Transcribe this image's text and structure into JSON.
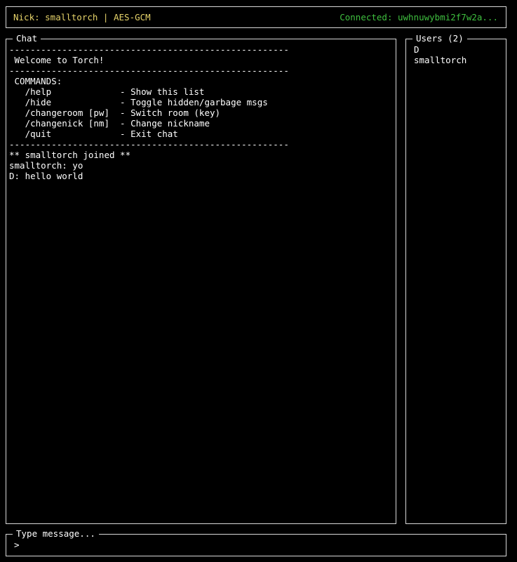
{
  "colors": {
    "nick": "#e6d36a",
    "connected": "#3fbf3f",
    "text": "#ffffff",
    "border": "#d8d8d8",
    "background": "#000000"
  },
  "status": {
    "left": "Nick: smalltorch | AES-GCM",
    "right": "Connected: uwhnuwybmi2f7w2a..."
  },
  "chat": {
    "title": "Chat",
    "lines": [
      "-----------------------------------------------------",
      " Welcome to Torch!",
      "-----------------------------------------------------",
      " COMMANDS:",
      "   /help             - Show this list",
      "   /hide             - Toggle hidden/garbage msgs",
      "   /changeroom [pw]  - Switch room (key)",
      "   /changenick [nm]  - Change nickname",
      "   /quit             - Exit chat",
      "-----------------------------------------------------",
      "** smalltorch joined **",
      "smalltorch: yo",
      "D: hello world"
    ]
  },
  "users": {
    "title": "Users (2)",
    "list": [
      "D",
      "smalltorch"
    ]
  },
  "input": {
    "title": "Type message...",
    "prompt": ">",
    "value": ""
  }
}
